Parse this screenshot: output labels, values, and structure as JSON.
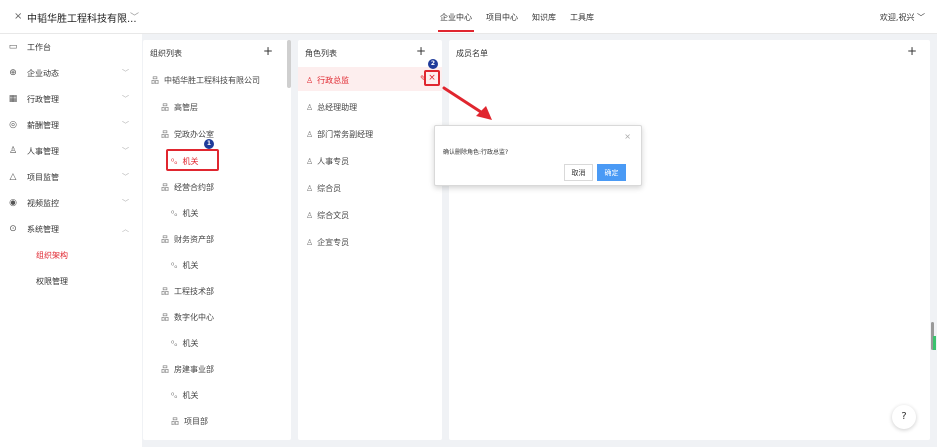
{
  "header": {
    "close_glyph": "×",
    "company": "中韬华胜工程科技有限...",
    "nav": [
      {
        "label": "企业中心",
        "active": true
      },
      {
        "label": "项目中心",
        "active": false
      },
      {
        "label": "知识库",
        "active": false
      },
      {
        "label": "工具库",
        "active": false
      }
    ],
    "user": "欢迎,祝兴 ﹀"
  },
  "sidebar": {
    "items": [
      {
        "label": "工作台",
        "icon": "monitor-icon",
        "glyph": "▭"
      },
      {
        "label": "企业动态",
        "icon": "globe-icon",
        "glyph": "⊕"
      },
      {
        "label": "行政管理",
        "icon": "grid-icon",
        "glyph": "▦"
      },
      {
        "label": "薪酬管理",
        "icon": "money-icon",
        "glyph": "◎"
      },
      {
        "label": "人事管理",
        "icon": "people-icon",
        "glyph": "♙"
      },
      {
        "label": "项目监管",
        "icon": "cloud-icon",
        "glyph": "△"
      },
      {
        "label": "视频监控",
        "icon": "camera-icon",
        "glyph": "◉"
      },
      {
        "label": "系统管理",
        "icon": "settings-icon",
        "glyph": "⊙"
      }
    ],
    "sub_items": [
      {
        "label": "组织架构",
        "active": true
      },
      {
        "label": "权限管理",
        "active": false
      }
    ]
  },
  "org_panel": {
    "title": "组织列表",
    "plus": "+",
    "items": [
      {
        "label": "中韬华胜工程科技有限公司",
        "glyph": "品"
      },
      {
        "label": "高管层",
        "glyph": "品"
      },
      {
        "label": "党政办公室",
        "glyph": "品"
      },
      {
        "label": "机关",
        "glyph": "⁰ₒ",
        "highlight": true
      },
      {
        "label": "经营合约部",
        "glyph": "品"
      },
      {
        "label": "机关",
        "glyph": "⁰ₒ"
      },
      {
        "label": "财务资产部",
        "glyph": "品"
      },
      {
        "label": "机关",
        "glyph": "⁰ₒ"
      },
      {
        "label": "工程技术部",
        "glyph": "品"
      },
      {
        "label": "数字化中心",
        "glyph": "品"
      },
      {
        "label": "机关",
        "glyph": "⁰ₒ"
      },
      {
        "label": "房建事业部",
        "glyph": "品"
      },
      {
        "label": "机关",
        "glyph": "⁰ₒ"
      },
      {
        "label": "项目部",
        "glyph": "品"
      }
    ]
  },
  "role_panel": {
    "title": "角色列表",
    "plus": "+",
    "items": [
      {
        "label": "行政总监",
        "active": true
      },
      {
        "label": "总经理助理"
      },
      {
        "label": "部门常务副经理"
      },
      {
        "label": "人事专员"
      },
      {
        "label": "综合员"
      },
      {
        "label": "综合文员"
      },
      {
        "label": "企宣专员"
      }
    ],
    "edit_glyph": "✎",
    "delete_glyph": "×"
  },
  "member_panel": {
    "title": "成员名单",
    "plus": "+"
  },
  "dialog": {
    "message": "确认删除角色:行政总监?",
    "cancel": "取消",
    "confirm": "确定",
    "close": "×"
  },
  "badges": {
    "one": "1",
    "two": "2"
  },
  "help": "?",
  "colors": {
    "accent": "#e0262f",
    "primary_button": "#4a9af5",
    "badge": "#1f3b9a"
  }
}
